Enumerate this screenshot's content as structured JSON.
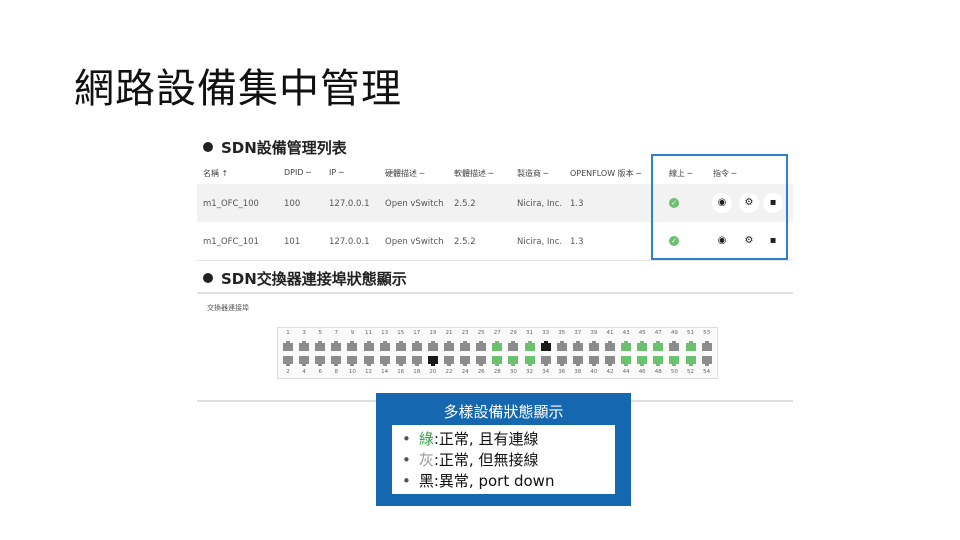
{
  "slide": {
    "title": "網路設備集中管理"
  },
  "device_list": {
    "heading": "SDN設備管理列表",
    "columns": {
      "name": "名稱 ↑",
      "dpid": "DPID ─",
      "ip": "IP ─",
      "hw_desc": "硬體描述 ─",
      "sw_desc": "軟體描述 ─",
      "manufacturer": "製造商 ─",
      "openflow": "OPENFLOW 版本 ─",
      "online": "線上 ─",
      "commands": "指令 ─"
    },
    "rows": [
      {
        "name": "m1_OFC_100",
        "dpid": "100",
        "ip": "127.0.0.1",
        "hw_desc": "Open vSwitch",
        "sw_desc": "2.5.2",
        "manufacturer": "Nicira, Inc.",
        "openflow": "1.3",
        "online": true
      },
      {
        "name": "m1_OFC_101",
        "dpid": "101",
        "ip": "127.0.0.1",
        "hw_desc": "Open vSwitch",
        "sw_desc": "2.5.2",
        "manufacturer": "Nicira, Inc.",
        "openflow": "1.3",
        "online": true
      }
    ],
    "action_icons": [
      "eye-icon",
      "gear-icon",
      "trash-icon"
    ]
  },
  "port_status": {
    "heading": "SDN交換器連接埠狀態顯示",
    "panel_label": "交換器連接埠",
    "top_numbers": [
      "1",
      "3",
      "5",
      "7",
      "9",
      "11",
      "13",
      "15",
      "17",
      "19",
      "21",
      "23",
      "25",
      "27",
      "29",
      "31",
      "33",
      "35",
      "37",
      "39",
      "41",
      "43",
      "45",
      "47",
      "49",
      "51",
      "53"
    ],
    "bottom_numbers": [
      "2",
      "4",
      "6",
      "8",
      "10",
      "12",
      "14",
      "16",
      "18",
      "20",
      "22",
      "24",
      "26",
      "28",
      "30",
      "32",
      "34",
      "36",
      "38",
      "40",
      "42",
      "44",
      "46",
      "48",
      "50",
      "52",
      "54"
    ],
    "top_states": [
      "gray",
      "gray",
      "gray",
      "gray",
      "gray",
      "gray",
      "gray",
      "gray",
      "gray",
      "gray",
      "gray",
      "gray",
      "gray",
      "green",
      "gray",
      "green",
      "black",
      "gray",
      "gray",
      "gray",
      "gray",
      "green",
      "green",
      "green",
      "gray",
      "green",
      "gray"
    ],
    "bottom_states": [
      "gray",
      "gray",
      "gray",
      "gray",
      "gray",
      "gray",
      "gray",
      "gray",
      "gray",
      "black",
      "gray",
      "gray",
      "gray",
      "green",
      "green",
      "green",
      "gray",
      "gray",
      "gray",
      "gray",
      "gray",
      "green",
      "green",
      "green",
      "green",
      "green",
      "gray"
    ],
    "colors": {
      "green": "#6cc070",
      "gray": "#8c8c8c",
      "black": "#1a1a1a"
    }
  },
  "legend": {
    "title": "多樣設備狀態顯示",
    "items": [
      {
        "color_word": "綠",
        "desc": ":正常, 且有連線",
        "color": "#2ea043"
      },
      {
        "color_word": "灰",
        "desc": ":正常, 但無接線",
        "color": "#9a9a9a"
      },
      {
        "color_word": "黑",
        "desc": ":異常, port down",
        "color": "#111111"
      }
    ]
  }
}
